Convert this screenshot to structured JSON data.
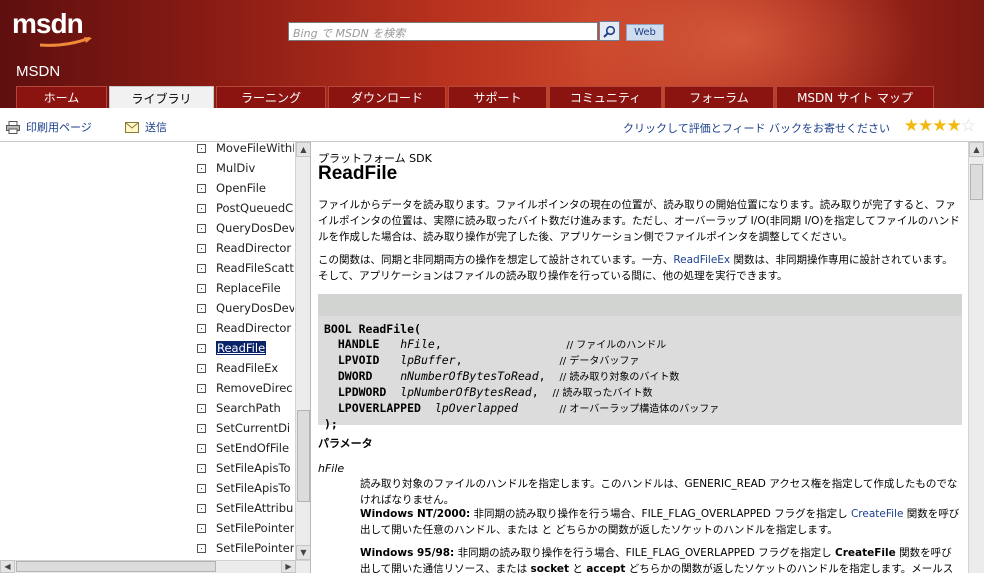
{
  "header": {
    "logo": "msdn",
    "search_placeholder": "Bing で MSDN を検索",
    "web_button": "Web",
    "site_name": "MSDN"
  },
  "nav": {
    "tabs": [
      {
        "label": "ホーム",
        "active": false
      },
      {
        "label": "ライブラリ",
        "active": true
      },
      {
        "label": "ラーニング",
        "active": false
      },
      {
        "label": "ダウンロード",
        "active": false
      },
      {
        "label": "サポート",
        "active": false
      },
      {
        "label": "コミュニティ",
        "active": false
      },
      {
        "label": "フォーラム",
        "active": false
      },
      {
        "label": "MSDN サイト マップ",
        "active": false
      }
    ]
  },
  "toolbar": {
    "print_label": "印刷用ページ",
    "send_label": "送信",
    "rate_text": "クリックして評価とフィード バックをお寄せください",
    "rating": 4.5
  },
  "sidebar": {
    "items": [
      {
        "label": "MoveFileWithP"
      },
      {
        "label": "MulDiv"
      },
      {
        "label": "OpenFile"
      },
      {
        "label": "PostQueuedC"
      },
      {
        "label": "QueryDosDev"
      },
      {
        "label": "ReadDirector"
      },
      {
        "label": "ReadFileScatt"
      },
      {
        "label": "ReplaceFile"
      },
      {
        "label": "QueryDosDev"
      },
      {
        "label": "ReadDirector"
      },
      {
        "label": "ReadFile",
        "selected": true
      },
      {
        "label": "ReadFileEx"
      },
      {
        "label": "RemoveDirec"
      },
      {
        "label": "SearchPath"
      },
      {
        "label": "SetCurrentDi"
      },
      {
        "label": "SetEndOfFile"
      },
      {
        "label": "SetFileApisTo"
      },
      {
        "label": "SetFileApisTo"
      },
      {
        "label": "SetFileAttribu"
      },
      {
        "label": "SetFilePointer"
      },
      {
        "label": "SetFilePointer"
      }
    ]
  },
  "content": {
    "platform": "プラットフォーム SDK",
    "title": "ReadFile",
    "para1": "ファイルからデータを読み取ります。ファイルポインタの現在の位置が、読み取りの開始位置になります。読み取りが完了すると、ファイルポインタの位置は、実際に読み取ったバイト数だけ進みます。ただし、オーバーラップ I/O(非同期 I/O)を指定してファイルのハンドルを作成した場合は、読み取り操作が完了した後、アプリケーション側でファイルポインタを調整してください。",
    "para2_a": "この関数は、同期と非同期両方の操作を想定して設計されています。一方、",
    "para2_link": "ReadFileEx",
    "para2_b": " 関数は、非同期操作専用に設計されています。そして、アプリケーションはファイルの読み取り操作を行っている間に、他の処理を実行できます。",
    "code": {
      "head": "BOOL ReadFile(",
      "params": [
        {
          "type": "HANDLE",
          "name": "hFile",
          "comment": "// ファイルのハンドル"
        },
        {
          "type": "LPVOID",
          "name": "lpBuffer",
          "comment": "// データバッファ"
        },
        {
          "type": "DWORD",
          "name": "nNumberOfBytesToRead",
          "comment": "// 読み取り対象のバイト数"
        },
        {
          "type": "LPDWORD",
          "name": "lpNumberOfBytesRead",
          "comment": "// 読み取ったバイト数"
        },
        {
          "type": "LPOVERLAPPED",
          "name": "lpOverlapped",
          "comment": "// オーバーラップ構造体のバッファ"
        }
      ],
      "tail": ");"
    },
    "params_heading": "パラメータ",
    "param_name": "hFile",
    "param_desc1": "読み取り対象のファイルのハンドルを指定します。このハンドルは、GENERIC_READ アクセス権を指定して作成したものでなければなりません。",
    "nt_label": "Windows NT/2000:",
    "nt_text_a": " 非同期の読み取り操作を行う場合、FILE_FLAG_OVERLAPPED フラグを指定し ",
    "nt_link": "CreateFile",
    "nt_text_b": " 関数を呼び出して開いた任意のハンドル、または と どちらかの関数が返したソケットのハンドルを指定します。",
    "w95_label": "Windows 95/98:",
    "w95_text_a": " 非同期の読み取り操作を行う場合、FILE_FLAG_OVERLAPPED フラグを指定し ",
    "w95_bold1": "CreateFile",
    "w95_text_b": " 関数を呼び出して開いた通信リソース、または ",
    "w95_bold2": "socket",
    "w95_text_c": " と ",
    "w95_bold3": "accept",
    "w95_text_d": " どちらかの関数が返したソケットのハンドルを指定します。メールス"
  }
}
